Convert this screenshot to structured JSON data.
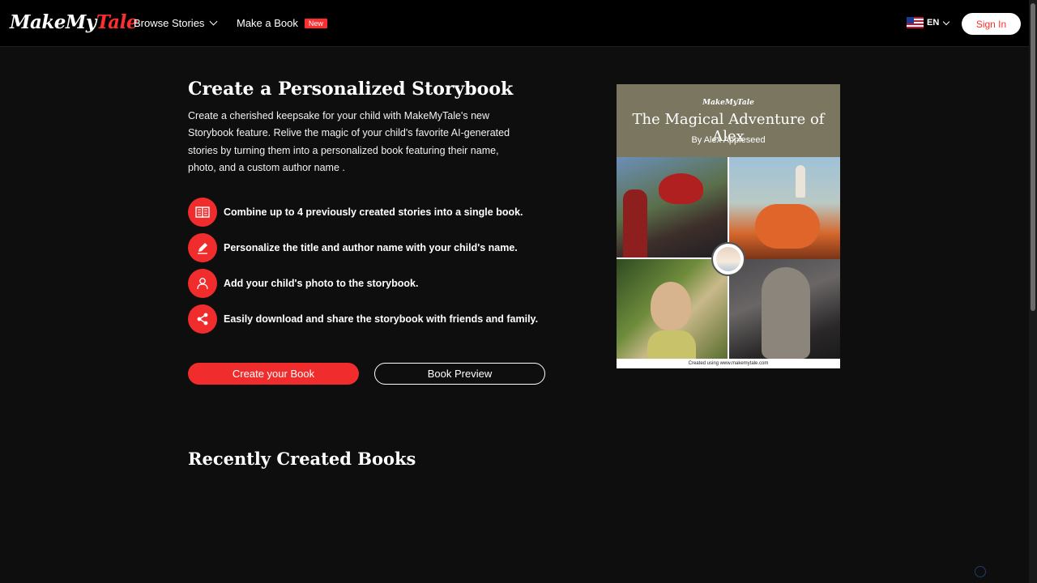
{
  "header": {
    "logo_part1": "MakeMy",
    "logo_part2": "Tale",
    "nav_browse": "Browse Stories",
    "nav_make": "Make a Book",
    "badge_new": "New",
    "language": "EN",
    "signin": "Sign In"
  },
  "hero": {
    "title": "Create a Personalized Storybook",
    "description": "Create a cherished keepsake for your child with MakeMyTale's new Storybook feature. Relive the magic of your child's favorite AI-generated stories by turning them into a personalized book featuring their name, photo, and a custom author name .",
    "features": [
      {
        "icon": "book-icon",
        "text": "Combine up to 4 previously created stories into a single book."
      },
      {
        "icon": "pencil-icon",
        "text": "Personalize the title and author name with your child's name."
      },
      {
        "icon": "user-icon",
        "text": "Add your child's photo to the storybook."
      },
      {
        "icon": "share-icon",
        "text": "Easily download and share the storybook with friends and family."
      }
    ],
    "create_button": "Create your Book",
    "preview_button": "Book Preview"
  },
  "book": {
    "logo": "MakeMyTale",
    "title": "The Magical Adventure of Alex",
    "author": "By Alex Appleseed",
    "footer": "Created using www.makemytale.com"
  },
  "recent": {
    "heading": "Recently Created Books"
  },
  "colors": {
    "accent": "#f12c2c",
    "background": "#0e0e0f",
    "header": "#000000"
  }
}
